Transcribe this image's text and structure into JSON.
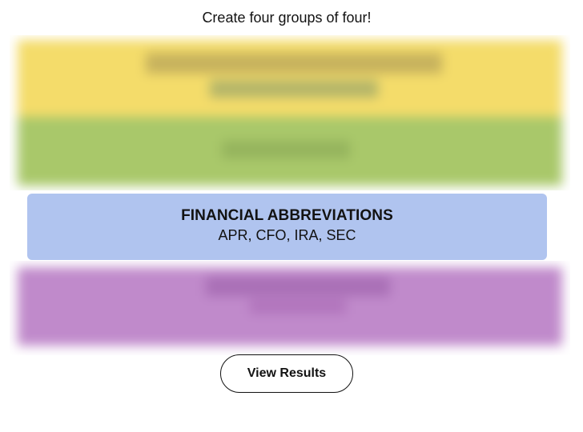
{
  "instruction": "Create four groups of four!",
  "hidden_groups": [
    {
      "color_name": "yellow",
      "color": "#f4dc6a"
    },
    {
      "color_name": "green",
      "color": "#a9c86a"
    },
    {
      "color_name": "purple",
      "color": "#c08acb"
    }
  ],
  "revealed_group": {
    "title": "FINANCIAL ABBREVIATIONS",
    "members": "APR, CFO, IRA, SEC",
    "color": "#b0c4ef"
  },
  "actions": {
    "view_results_label": "View Results"
  }
}
